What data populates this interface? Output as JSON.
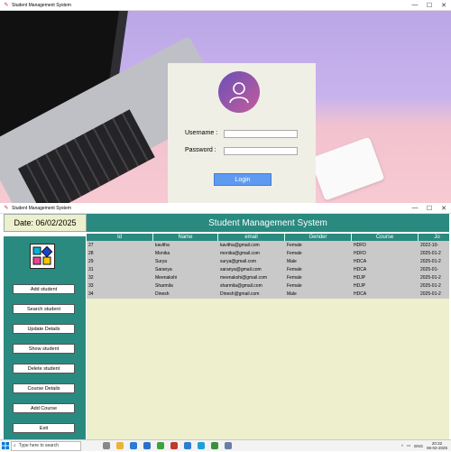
{
  "login_window": {
    "title": "Student Management System",
    "controls": {
      "minimize": "—",
      "maximize": "☐",
      "close": "✕"
    },
    "username_label": "Username :",
    "password_label": "Password :",
    "username_value": "",
    "password_value": "",
    "login_label": "Login"
  },
  "main_window": {
    "title": "Student Management System",
    "controls": {
      "minimize": "—",
      "maximize": "☐",
      "close": "✕"
    },
    "date_text": "Date: 06/02/2025",
    "header_title": "Student Management System",
    "sidebar_buttons": [
      "Add student",
      "Search student",
      "Update Details",
      "Show student",
      "Delete student",
      "Course Details",
      "Add Course",
      "Exit"
    ],
    "table": {
      "columns": [
        "Id",
        "Name",
        "email",
        "Gender",
        "Course",
        "Jo"
      ],
      "rows": [
        [
          "27",
          "kavitha",
          "kavitha@gmail.com",
          "Female",
          "HDFD",
          "2022-10-"
        ],
        [
          "28",
          "Monika",
          "monika@gmail.com",
          "Female",
          "HDFD",
          "2025-01-2"
        ],
        [
          "29",
          "Surya",
          "surya@gmail.com",
          "Male",
          "HDCA",
          "2025-01-2"
        ],
        [
          "31",
          "Saranya",
          "saranya@gmail.com",
          "Female",
          "HDCA",
          "2025-01-"
        ],
        [
          "32",
          "Meenakshi",
          "meenakshi@gmail.com",
          "Female",
          "HDJP",
          "2025-01-2"
        ],
        [
          "33",
          "Sharmila",
          "sharmila@gmail.com",
          "Female",
          "HDJP",
          "2025-01-2"
        ],
        [
          "34",
          "Dinesh",
          "Dinesh@gmail.com",
          "Male",
          "HDCA",
          "2025-01-2"
        ]
      ]
    }
  },
  "taskbar": {
    "search_placeholder": "Type here to search",
    "language": "ENG",
    "time": "20:32",
    "date": "06-02-2025"
  },
  "colors": {
    "teal": "#2a8a80",
    "cream": "#eef0cd",
    "login_button": "#5e9af0"
  }
}
